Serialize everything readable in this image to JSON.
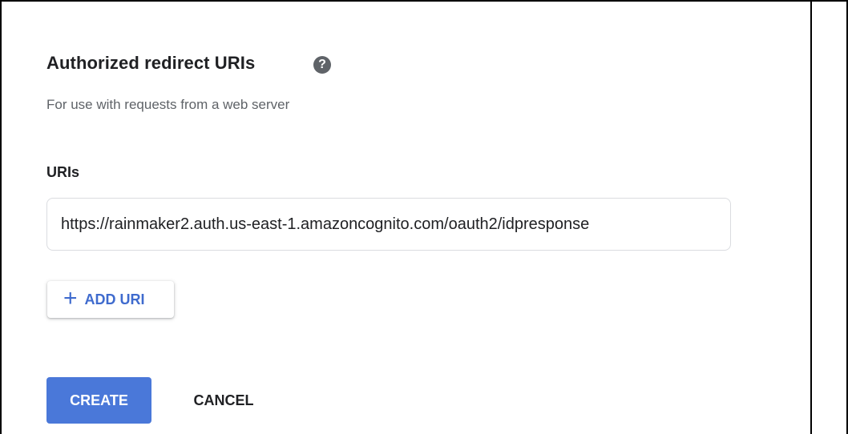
{
  "section": {
    "title": "Authorized redirect URIs",
    "help_icon": "help-circle-icon",
    "subtitle": "For use with requests from a web server"
  },
  "uris": {
    "label": "URIs",
    "items": [
      {
        "value": "https://rainmaker2.auth.us-east-1.amazoncognito.com/oauth2/idpresponse"
      }
    ],
    "add_button_label": "ADD URI",
    "add_icon": "plus-icon"
  },
  "actions": {
    "create_label": "CREATE",
    "cancel_label": "CANCEL"
  },
  "colors": {
    "primary": "#4a78d9",
    "link": "#3f6bce",
    "text": "#202124",
    "muted": "#5f6368"
  }
}
